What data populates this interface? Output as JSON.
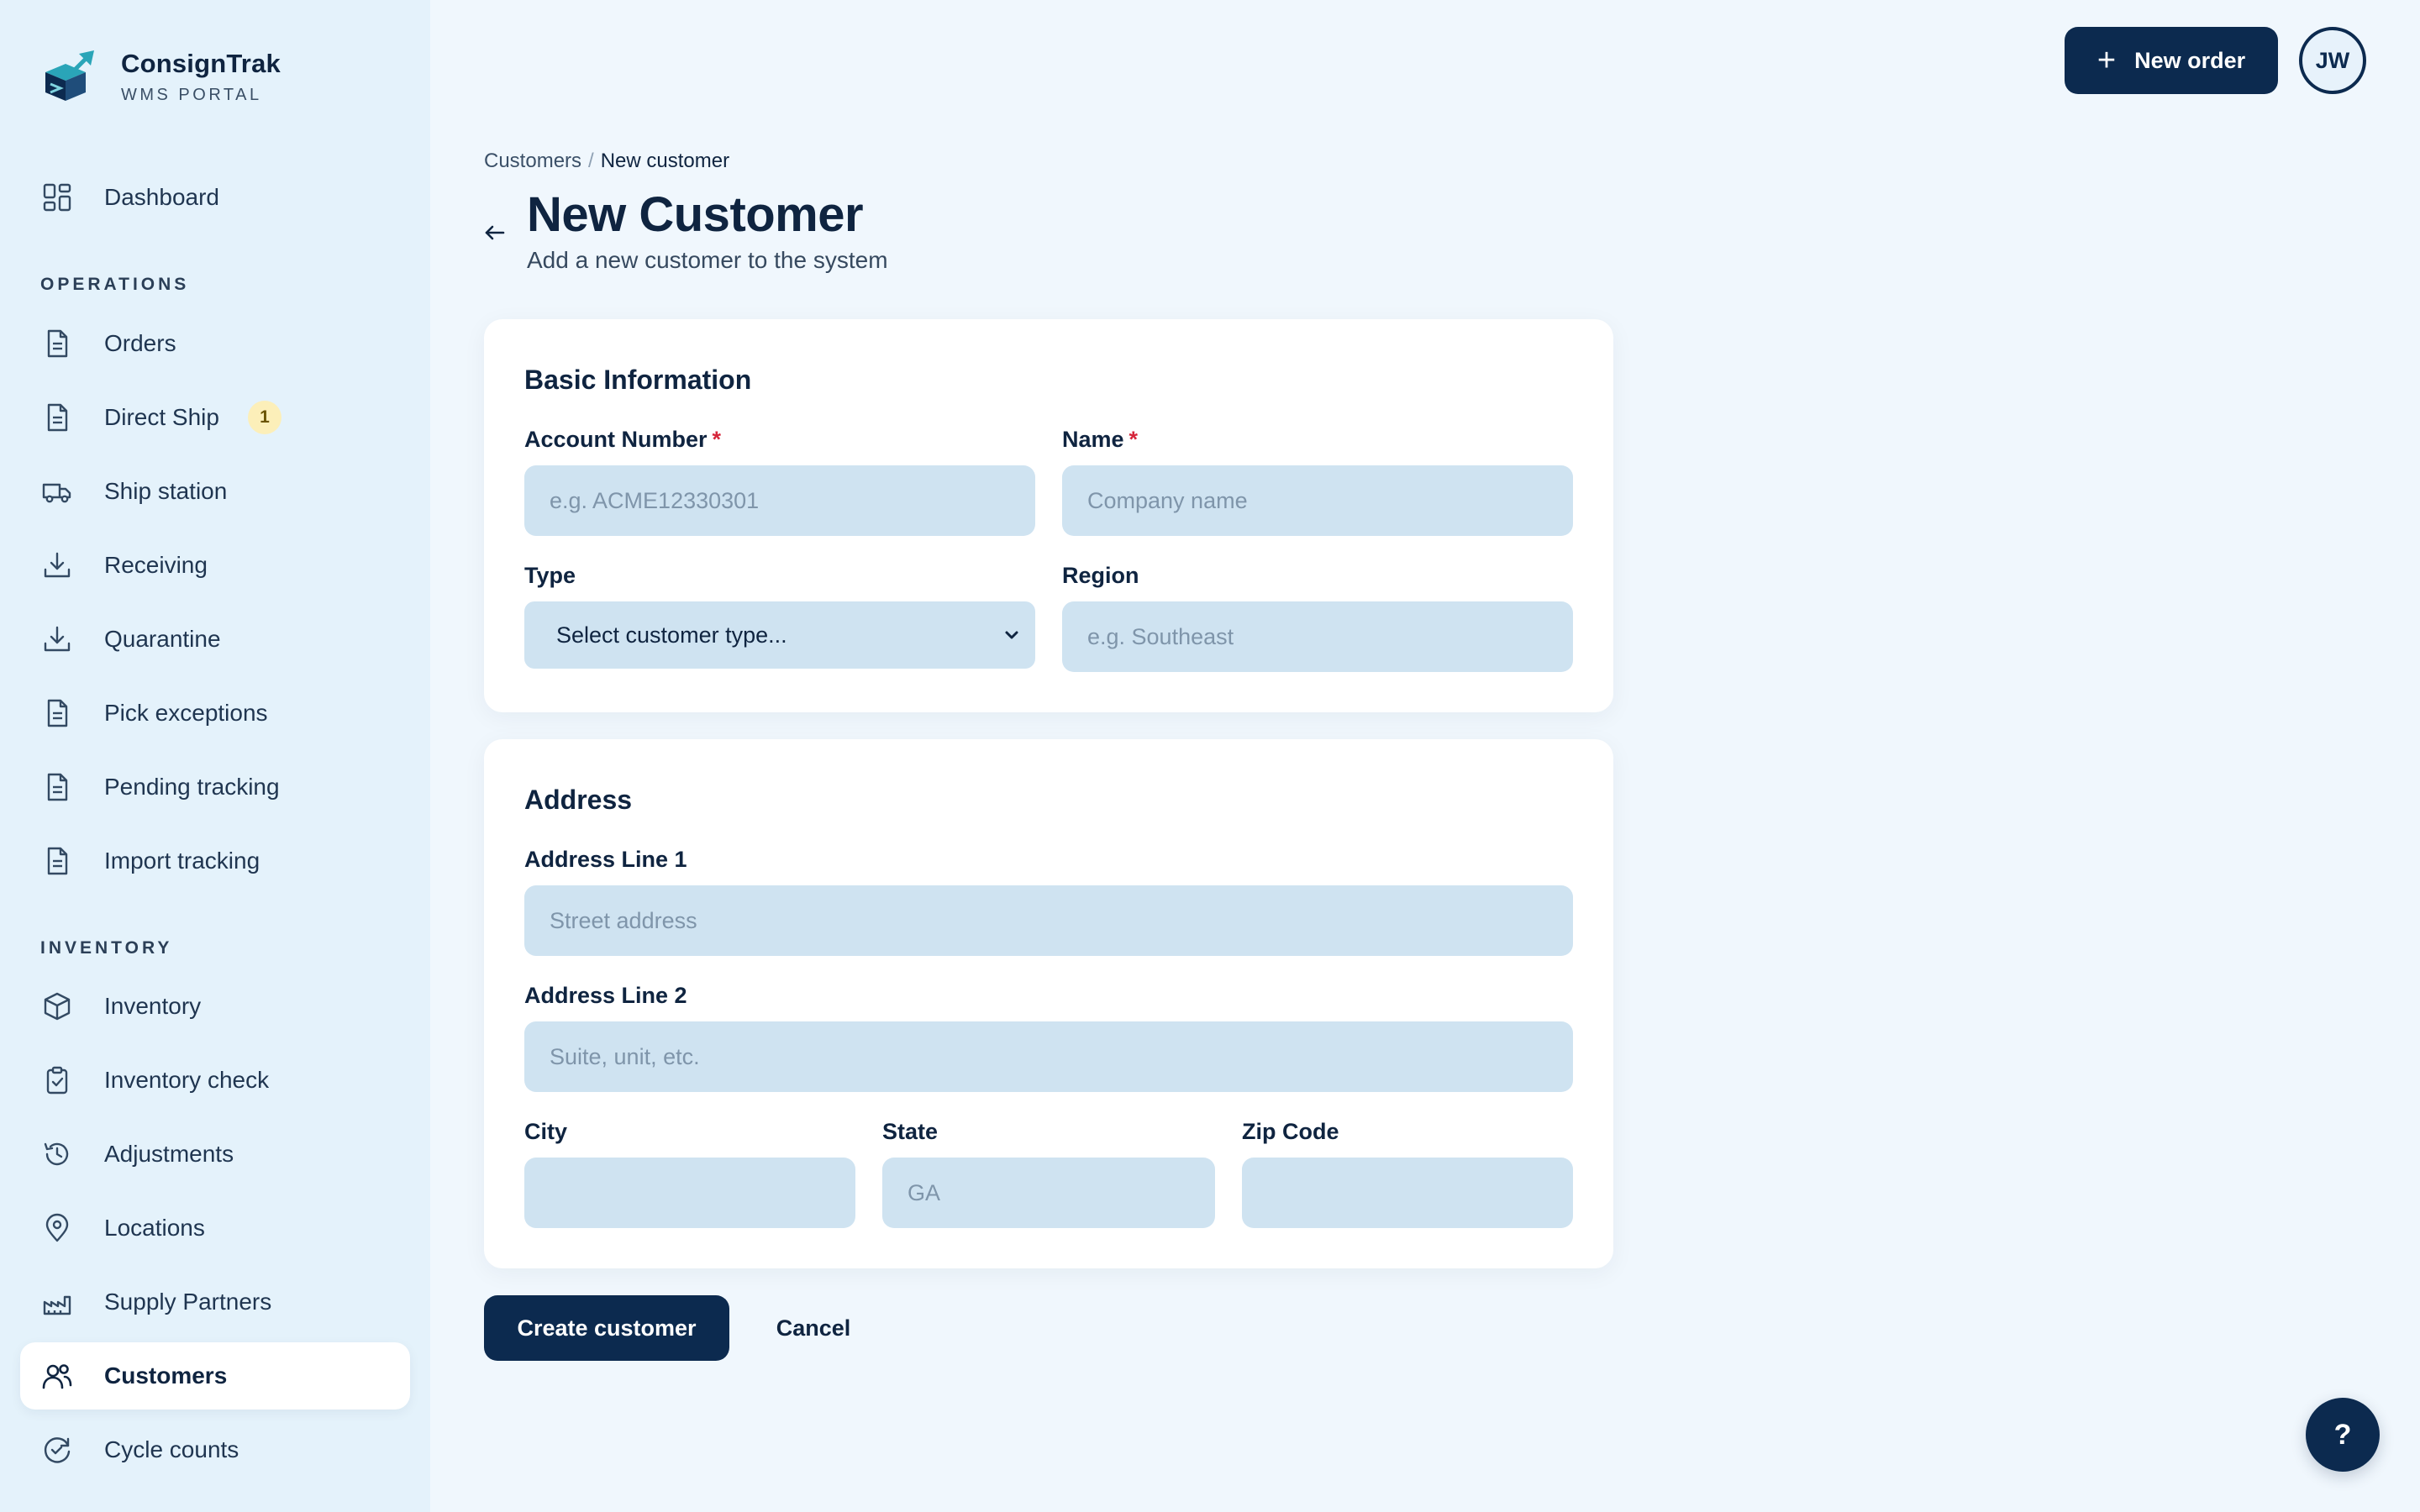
{
  "brand": {
    "name": "ConsignTrak",
    "subtitle": "WMS PORTAL"
  },
  "sidebar": {
    "dashboard": {
      "label": "Dashboard",
      "icon": "dashboard-grid-icon"
    },
    "sections": [
      {
        "label": "OPERATIONS"
      },
      {
        "label": "INVENTORY"
      }
    ],
    "items": [
      {
        "label": "Orders",
        "icon": "document-icon"
      },
      {
        "label": "Direct Ship",
        "icon": "document-icon",
        "badge": "1"
      },
      {
        "label": "Ship station",
        "icon": "truck-icon"
      },
      {
        "label": "Receiving",
        "icon": "download-icon"
      },
      {
        "label": "Quarantine",
        "icon": "download-icon"
      },
      {
        "label": "Pick exceptions",
        "icon": "document-icon"
      },
      {
        "label": "Pending tracking",
        "icon": "document-icon"
      },
      {
        "label": "Import tracking",
        "icon": "document-icon"
      },
      {
        "label": "Inventory",
        "icon": "box-icon"
      },
      {
        "label": "Inventory check",
        "icon": "clipboard-check-icon"
      },
      {
        "label": "Adjustments",
        "icon": "history-icon"
      },
      {
        "label": "Locations",
        "icon": "map-pin-icon"
      },
      {
        "label": "Supply Partners",
        "icon": "factory-icon"
      },
      {
        "label": "Customers",
        "icon": "users-icon",
        "active": true
      },
      {
        "label": "Cycle counts",
        "icon": "refresh-check-icon"
      }
    ]
  },
  "topbar": {
    "new_order_label": "New order",
    "avatar_initials": "JW"
  },
  "breadcrumb": {
    "parent": "Customers",
    "separator": "/",
    "current": "New customer"
  },
  "header": {
    "title": "New Customer",
    "subtitle": "Add a new customer to the system"
  },
  "basic_info": {
    "title": "Basic Information",
    "account_number": {
      "label": "Account Number",
      "required": "*",
      "placeholder": "e.g. ACME12330301",
      "value": ""
    },
    "name": {
      "label": "Name",
      "required": "*",
      "placeholder": "Company name",
      "value": ""
    },
    "type": {
      "label": "Type",
      "selected": "Select customer type..."
    },
    "region": {
      "label": "Region",
      "placeholder": "e.g. Southeast",
      "value": ""
    }
  },
  "address": {
    "title": "Address",
    "line1": {
      "label": "Address Line 1",
      "placeholder": "Street address",
      "value": ""
    },
    "line2": {
      "label": "Address Line 2",
      "placeholder": "Suite, unit, etc.",
      "value": ""
    },
    "city": {
      "label": "City",
      "placeholder": "",
      "value": ""
    },
    "state": {
      "label": "State",
      "placeholder": "GA",
      "value": ""
    },
    "zip": {
      "label": "Zip Code",
      "placeholder": "",
      "value": ""
    }
  },
  "actions": {
    "create_label": "Create customer",
    "cancel_label": "Cancel"
  },
  "help": {
    "label": "?"
  },
  "colors": {
    "primary": "#0c2a4f",
    "sidebar_bg": "#e4f2fb",
    "page_bg": "#f0f7fd",
    "input_bg": "#cfe3f1",
    "required": "#d6263b",
    "badge_bg": "#fcefb9"
  }
}
